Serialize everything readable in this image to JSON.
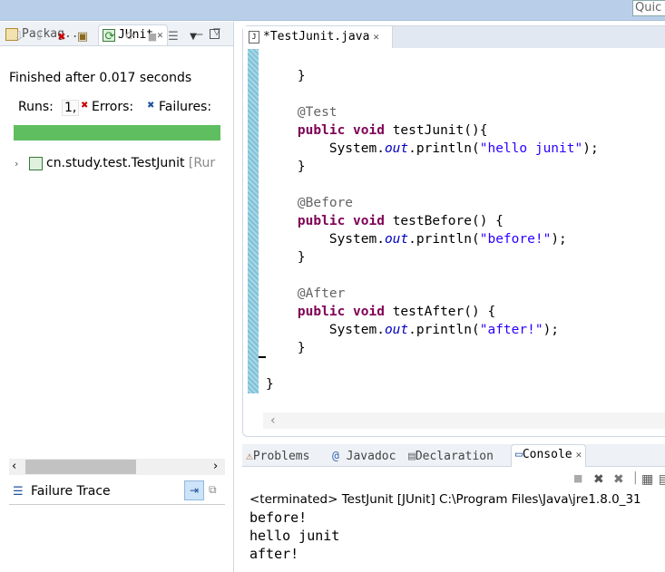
{
  "quick_access": "Quic",
  "left_pane": {
    "tabs": [
      {
        "label": "Packag..."
      },
      {
        "label": "JUnit"
      }
    ],
    "finished_text": "Finished after 0.017 seconds",
    "runs_label": "Runs:",
    "runs_value": "1,",
    "errors_label": "Errors:",
    "failures_label": "Failures:",
    "progress_fraction": 1.0,
    "progress_color": "#5fbe5f",
    "tree_item": "cn.study.test.TestJunit",
    "tree_suffix": "[Rur",
    "failure_trace_label": "Failure Trace"
  },
  "editor": {
    "tab_label": "*TestJunit.java",
    "lines": [
      {
        "indent": "    ",
        "parts": [
          {
            "t": "}",
            "c": ""
          }
        ]
      },
      {
        "indent": "",
        "parts": []
      },
      {
        "indent": "    ",
        "parts": [
          {
            "t": "@Test",
            "c": "ann"
          }
        ]
      },
      {
        "indent": "    ",
        "parts": [
          {
            "t": "public",
            "c": "kw"
          },
          {
            "t": " ",
            "c": ""
          },
          {
            "t": "void",
            "c": "kw"
          },
          {
            "t": " testJunit(){",
            "c": ""
          }
        ]
      },
      {
        "indent": "        ",
        "parts": [
          {
            "t": "System.",
            "c": ""
          },
          {
            "t": "out",
            "c": "fld"
          },
          {
            "t": ".println(",
            "c": ""
          },
          {
            "t": "\"hello junit\"",
            "c": "str"
          },
          {
            "t": ");",
            "c": ""
          }
        ]
      },
      {
        "indent": "    ",
        "parts": [
          {
            "t": "}",
            "c": ""
          }
        ]
      },
      {
        "indent": "",
        "parts": []
      },
      {
        "indent": "    ",
        "parts": [
          {
            "t": "@Before",
            "c": "ann"
          }
        ]
      },
      {
        "indent": "    ",
        "parts": [
          {
            "t": "public",
            "c": "kw"
          },
          {
            "t": " ",
            "c": ""
          },
          {
            "t": "void",
            "c": "kw"
          },
          {
            "t": " testBefore() {",
            "c": ""
          }
        ]
      },
      {
        "indent": "        ",
        "parts": [
          {
            "t": "System.",
            "c": ""
          },
          {
            "t": "out",
            "c": "fld"
          },
          {
            "t": ".println(",
            "c": ""
          },
          {
            "t": "\"before!\"",
            "c": "str"
          },
          {
            "t": ");",
            "c": ""
          }
        ]
      },
      {
        "indent": "    ",
        "parts": [
          {
            "t": "}",
            "c": ""
          }
        ]
      },
      {
        "indent": "",
        "parts": []
      },
      {
        "indent": "    ",
        "parts": [
          {
            "t": "@After",
            "c": "ann"
          }
        ]
      },
      {
        "indent": "    ",
        "parts": [
          {
            "t": "public",
            "c": "kw"
          },
          {
            "t": " ",
            "c": ""
          },
          {
            "t": "void",
            "c": "kw"
          },
          {
            "t": " testAfter() {",
            "c": ""
          }
        ]
      },
      {
        "indent": "        ",
        "parts": [
          {
            "t": "System.",
            "c": ""
          },
          {
            "t": "out",
            "c": "fld"
          },
          {
            "t": ".println(",
            "c": ""
          },
          {
            "t": "\"after!\"",
            "c": "str"
          },
          {
            "t": ");",
            "c": ""
          }
        ]
      },
      {
        "indent": "    ",
        "parts": [
          {
            "t": "}",
            "c": ""
          }
        ]
      },
      {
        "indent": "",
        "parts": []
      },
      {
        "indent": "",
        "parts": [
          {
            "t": "}",
            "c": ""
          }
        ]
      }
    ]
  },
  "bottom_pane": {
    "tabs": [
      {
        "label": "Problems"
      },
      {
        "label": "Javadoc"
      },
      {
        "label": "Declaration"
      },
      {
        "label": "Console"
      }
    ],
    "terminated_line": "<terminated> TestJunit [JUnit] C:\\Program Files\\Java\\jre1.8.0_31",
    "output": [
      "before!",
      "hello junit",
      "after!"
    ]
  },
  "colors": {
    "keyword": "#7f0055",
    "annotation": "#646464",
    "string": "#2a00ff",
    "static_field": "#0000c0"
  }
}
